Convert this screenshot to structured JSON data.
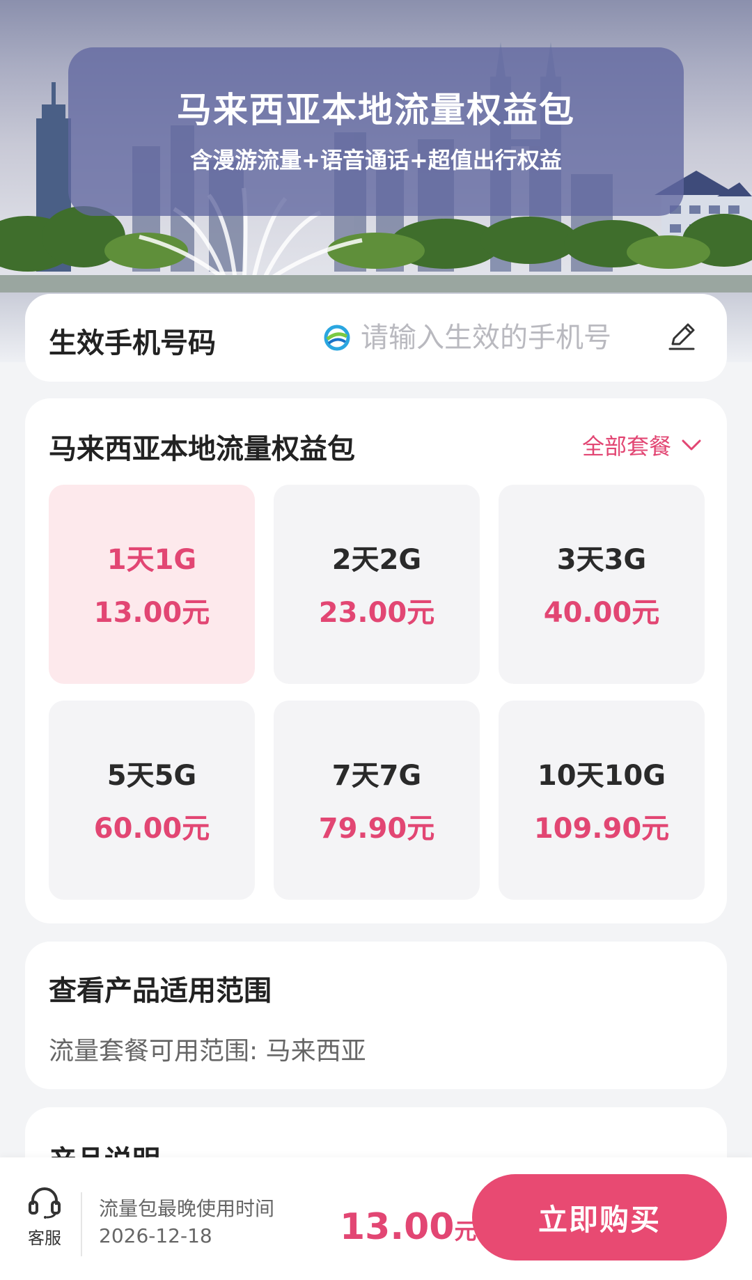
{
  "hero": {
    "title": "马来西亚本地流量权益包",
    "subtitle": "含漫游流量+语音通话+超值出行权益"
  },
  "phone": {
    "label": "生效手机号码",
    "value": "",
    "placeholder": "请输入生效的手机号",
    "logo_icon": "china-mobile-logo",
    "edit_icon": "pencil-icon"
  },
  "plans": {
    "title": "马来西亚本地流量权益包",
    "all_label": "全部套餐",
    "all_icon": "chevron-down-icon",
    "selected_index": 0,
    "items": [
      {
        "name": "1天1G",
        "price": "13.00元"
      },
      {
        "name": "2天2G",
        "price": "23.00元"
      },
      {
        "name": "3天3G",
        "price": "40.00元"
      },
      {
        "name": "5天5G",
        "price": "60.00元"
      },
      {
        "name": "7天7G",
        "price": "79.90元"
      },
      {
        "name": "10天10G",
        "price": "109.90元"
      }
    ]
  },
  "scope": {
    "title": "查看产品适用范围",
    "text": "流量套餐可用范围: 马来西亚"
  },
  "description": {
    "title": "产品说明"
  },
  "bottom": {
    "service_label": "客服",
    "service_icon": "headset-icon",
    "deadline_label": "流量包最晚使用时间",
    "deadline_date": "2026-12-18",
    "total_amount": "13.00",
    "total_unit": "元",
    "buy_label": "立即购买"
  },
  "colors": {
    "accent": "#e24673",
    "button": "#e84a72",
    "selected_bg": "#fde9ec",
    "hero_card": "#6268a0"
  }
}
